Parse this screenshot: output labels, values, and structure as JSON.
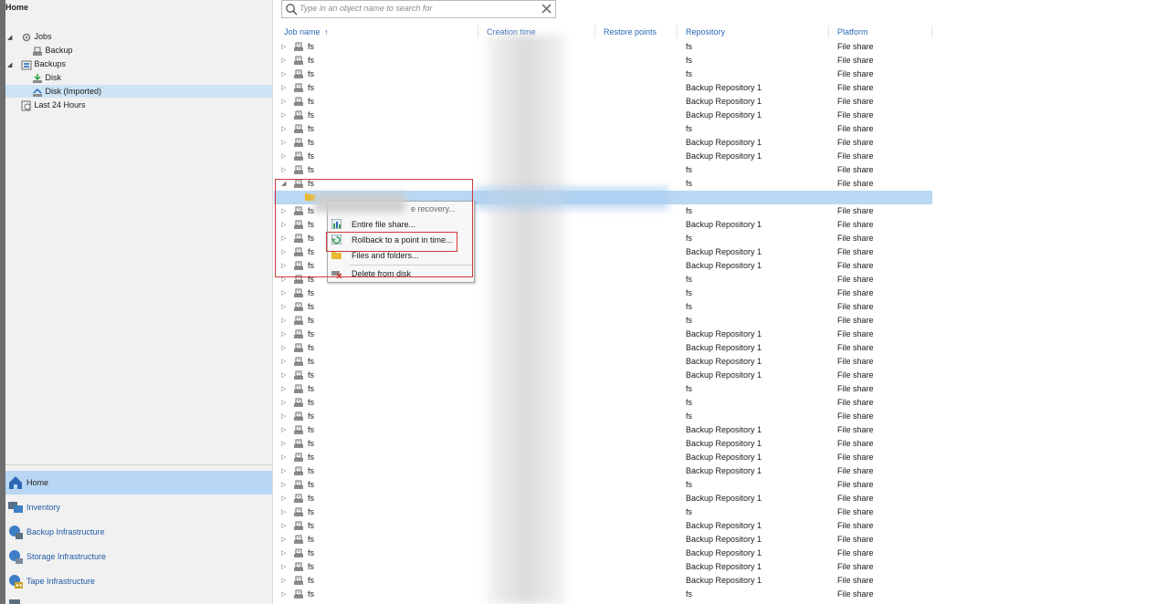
{
  "left_panel": {
    "title": "Home",
    "tree": [
      {
        "label": "Jobs",
        "icon": "jobs-gear-icon",
        "expanded": true
      },
      {
        "label": "Backup",
        "icon": "backup-job-icon"
      },
      {
        "label": "Backups",
        "icon": "backups-folder-icon",
        "expanded": true
      },
      {
        "label": "Disk",
        "icon": "disk-download-icon"
      },
      {
        "label": "Disk (Imported)",
        "icon": "disk-imported-icon",
        "selected": true
      },
      {
        "label": "Last 24 Hours",
        "icon": "last24-icon"
      }
    ],
    "nav": [
      {
        "label": "Home",
        "icon": "home-icon",
        "active": true
      },
      {
        "label": "Inventory",
        "icon": "inventory-icon"
      },
      {
        "label": "Backup Infrastructure",
        "icon": "backup-infrastructure-icon"
      },
      {
        "label": "Storage Infrastructure",
        "icon": "storage-infrastructure-icon"
      },
      {
        "label": "Tape Infrastructure",
        "icon": "tape-infrastructure-icon"
      }
    ]
  },
  "search": {
    "placeholder": "Type in an object name to search for"
  },
  "columns": [
    "Job name",
    "Creation time",
    "Restore points",
    "Repository",
    "Platform"
  ],
  "sort_indicator": "↑",
  "rows": [
    {
      "name": "fs",
      "repository": "fs",
      "platform": "File share"
    },
    {
      "name": "fs",
      "repository": "fs",
      "platform": "File share"
    },
    {
      "name": "fs",
      "repository": "fs",
      "platform": "File share"
    },
    {
      "name": "fs",
      "repository": "Backup Repository 1",
      "platform": "File share"
    },
    {
      "name": "fs",
      "repository": "Backup Repository 1",
      "platform": "File share"
    },
    {
      "name": "fs",
      "repository": "Backup Repository 1",
      "platform": "File share"
    },
    {
      "name": "fs",
      "repository": "fs",
      "platform": "File share"
    },
    {
      "name": "fs",
      "repository": "Backup Repository 1",
      "platform": "File share"
    },
    {
      "name": "fs",
      "repository": "Backup Repository 1",
      "platform": "File share"
    },
    {
      "name": "fs",
      "repository": "fs",
      "platform": "File share"
    },
    {
      "name": "fs",
      "repository": "fs",
      "platform": "File share",
      "expanded": true
    },
    {
      "name": "",
      "repository": "",
      "platform": "",
      "selected": true,
      "child": true
    },
    {
      "name": "fs",
      "repository": "fs",
      "platform": "File share"
    },
    {
      "name": "fs",
      "repository": "Backup Repository 1",
      "platform": "File share"
    },
    {
      "name": "fs",
      "repository": "fs",
      "platform": "File share"
    },
    {
      "name": "fs",
      "repository": "Backup Repository 1",
      "platform": "File share"
    },
    {
      "name": "fs",
      "repository": "Backup Repository 1",
      "platform": "File share"
    },
    {
      "name": "fs",
      "repository": "fs",
      "platform": "File share"
    },
    {
      "name": "fs",
      "repository": "fs",
      "platform": "File share"
    },
    {
      "name": "fs",
      "repository": "fs",
      "platform": "File share"
    },
    {
      "name": "fs",
      "repository": "fs",
      "platform": "File share"
    },
    {
      "name": "fs",
      "repository": "Backup Repository 1",
      "platform": "File share"
    },
    {
      "name": "fs",
      "repository": "Backup Repository 1",
      "platform": "File share"
    },
    {
      "name": "fs",
      "repository": "Backup Repository 1",
      "platform": "File share"
    },
    {
      "name": "fs",
      "repository": "Backup Repository 1",
      "platform": "File share"
    },
    {
      "name": "fs",
      "repository": "fs",
      "platform": "File share"
    },
    {
      "name": "fs",
      "repository": "fs",
      "platform": "File share"
    },
    {
      "name": "fs",
      "repository": "fs",
      "platform": "File share"
    },
    {
      "name": "fs",
      "repository": "Backup Repository 1",
      "platform": "File share"
    },
    {
      "name": "fs",
      "repository": "Backup Repository 1",
      "platform": "File share"
    },
    {
      "name": "fs",
      "repository": "Backup Repository 1",
      "platform": "File share"
    },
    {
      "name": "fs",
      "repository": "Backup Repository 1",
      "platform": "File share"
    },
    {
      "name": "fs",
      "repository": "fs",
      "platform": "File share"
    },
    {
      "name": "fs",
      "repository": "Backup Repository 1",
      "platform": "File share"
    },
    {
      "name": "fs",
      "repository": "fs",
      "platform": "File share"
    },
    {
      "name": "fs",
      "repository": "Backup Repository 1",
      "platform": "File share"
    },
    {
      "name": "fs",
      "repository": "Backup Repository 1",
      "platform": "File share"
    },
    {
      "name": "fs",
      "repository": "Backup Repository 1",
      "platform": "File share"
    },
    {
      "name": "fs",
      "repository": "Backup Repository 1",
      "platform": "File share"
    },
    {
      "name": "fs",
      "repository": "Backup Repository 1",
      "platform": "File share"
    },
    {
      "name": "fs",
      "repository": "fs",
      "platform": "File share"
    }
  ],
  "context_menu": {
    "partial_item": "e recovery...",
    "items": [
      {
        "label": "Entire file share...",
        "icon": "entire-file-share-icon"
      },
      {
        "label": "Rollback to a point in time...",
        "icon": "rollback-icon"
      },
      {
        "label": "Files and folders...",
        "icon": "files-folders-icon"
      },
      {
        "label": "Delete from disk",
        "icon": "delete-from-disk-icon"
      }
    ]
  },
  "colors": {
    "accent": "#2c68b3",
    "selection": "#b9d8f4",
    "nav_active": "#b9d7f4",
    "highlight_box": "#d03a3a"
  }
}
